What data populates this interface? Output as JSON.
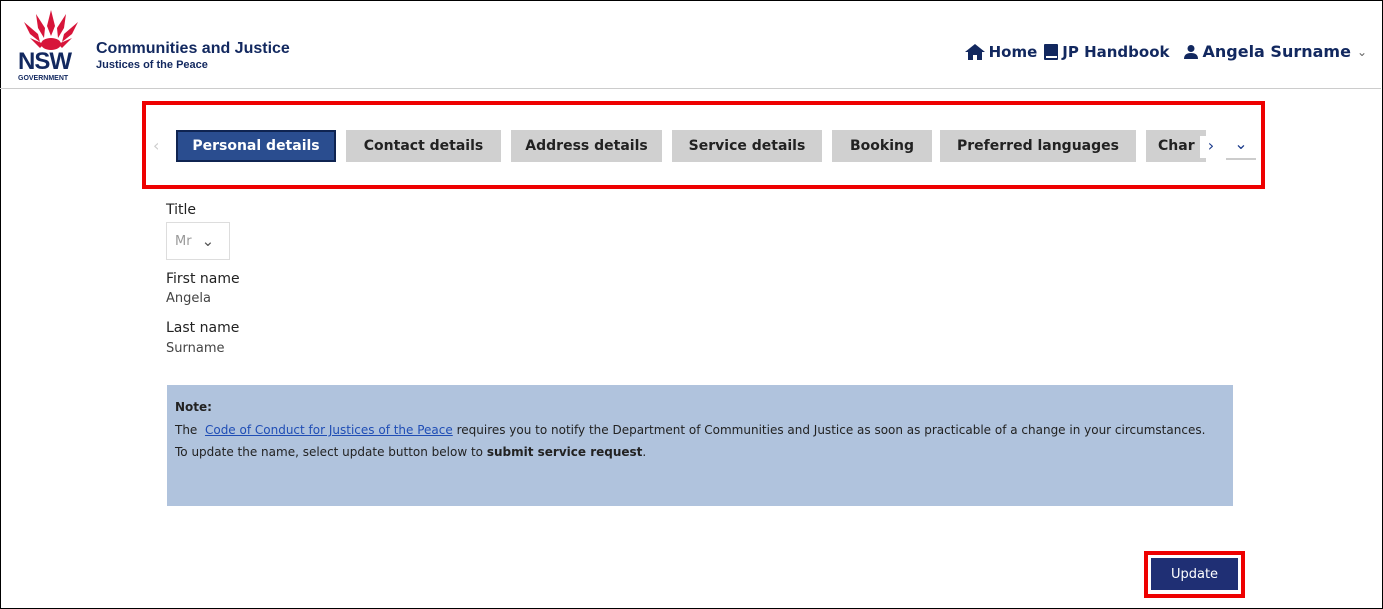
{
  "brand": {
    "logo_text": "NSW",
    "logo_sub": "GOVERNMENT",
    "org_name": "Communities and Justice",
    "org_sub": "Justices of the Peace",
    "color_navy": "#12285f"
  },
  "topnav": {
    "home_label": "Home",
    "handbook_label": "JP Handbook",
    "user_label": "Angela Surname"
  },
  "tabs": [
    {
      "label": "Personal details",
      "active": true
    },
    {
      "label": "Contact details",
      "active": false
    },
    {
      "label": "Address details",
      "active": false
    },
    {
      "label": "Service details",
      "active": false
    },
    {
      "label": "Booking",
      "active": false
    },
    {
      "label": "Preferred languages",
      "active": false
    },
    {
      "label": "Char",
      "active": false
    }
  ],
  "form": {
    "title_label": "Title",
    "title_value": "Mr",
    "first_name_label": "First name",
    "first_name_value": "Angela",
    "last_name_label": "Last name",
    "last_name_value": "Surname"
  },
  "note": {
    "title": "Note:",
    "line1_prefix": "The",
    "link_text": "Code of Conduct for Justices of the Peace",
    "line1_suffix": " requires you to notify the Department of Communities and Justice as soon as practicable of a change in your circumstances.",
    "line2_prefix": "To update the name, select update button below to ",
    "line2_bold": "submit service request",
    "line2_suffix": "."
  },
  "actions": {
    "update_label": "Update"
  },
  "colors": {
    "active_tab": "#2a4d8f",
    "inactive_tab": "#d0d0d0",
    "note_bg": "#b0c3dd",
    "highlight": "#e00000",
    "button": "#1f2f74"
  }
}
